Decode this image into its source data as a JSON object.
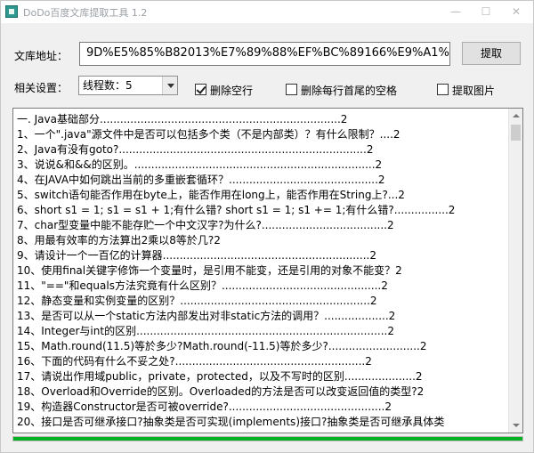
{
  "window": {
    "title": "DoDo百度文库提取工具  1.2",
    "controls": [
      "minimize-icon",
      "maximize-icon",
      "close-icon"
    ]
  },
  "url": {
    "label": "文库地址：",
    "value": "9D%E5%85%B82013%E7%89%88%EF%BC%89166%E9%A1%B5",
    "fetch_button": "提取"
  },
  "settings": {
    "label": "相关设置：",
    "threads_selected": "线程数：5",
    "remove_empty_lines": {
      "label": "删除空行",
      "checked": true
    },
    "trim_line_spaces": {
      "label": "删除每行首尾的空格",
      "checked": false
    },
    "extract_images": {
      "label": "提取图片",
      "checked": false
    }
  },
  "content": {
    "lines": [
      "一. Java基础部分.......................................................................2",
      "1、一个\".java\"源文件中是否可以包括多个类（不是内部类）？有什么限制？....2",
      "2、Java有没有goto?.........................................................................2",
      "3、说说&和&&的区别。.......................................................................2",
      "4、在JAVA中如何跳出当前的多重嵌套循环？............................................2",
      "5、switch语句能否作用在byte上，能否作用在long上，能否作用在String上?...2",
      "6、short s1 = 1; s1 = s1 + 1;有什么错? short s1 = 1; s1 += 1;有什么错?................2",
      "7、char型变量中能不能存贮一个中文汉字?为什么?.....................................2",
      "8、用最有效率的方法算出2乘以8等於几?2",
      "9、请设计一个一百亿的计算器.............................................................2",
      "10、使用final关键字修饰一个变量时，是引用不能变，还是引用的对象不能变？2",
      "11、\"==\"和equals方法究竟有什么区别？...............................................2",
      "12、静态变量和实例变量的区别？........................................................2",
      "13、是否可以从一个static方法内部发出对非static方法的调用？...................2",
      "14、Integer与int的区别..........................................................................2",
      "15、Math.round(11.5)等於多少?Math.round(-11.5)等於多少?...........................2",
      "16、下面的代码有什么不妥之处?........................................................2",
      "17、请说出作用域public，private，protected，以及不写时的区别.....................2",
      "18、Overload和Override的区别。Overloaded的方法是否可以改变返回值的类型?2",
      "19、构造器Constructor是否可被override?..............................................2",
      "20、接口是否可继承接口?抽象类是否可实现(implements)接口?抽象类是否可继承具体类"
    ]
  },
  "progress": {
    "value": 1.0,
    "color": "#06b025"
  }
}
